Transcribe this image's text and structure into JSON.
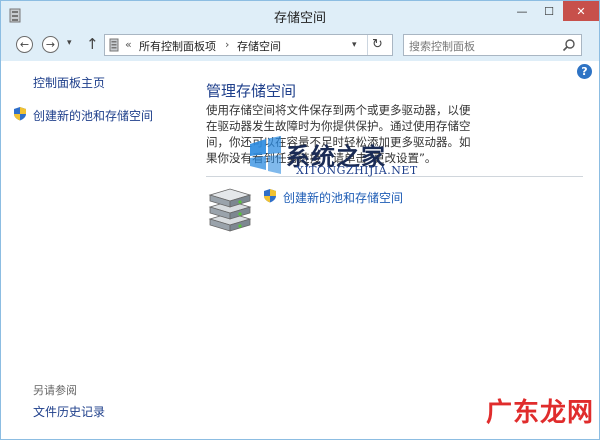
{
  "window": {
    "title": "存储空间"
  },
  "titlebar": {
    "minimize": "—",
    "maximize": "☐",
    "close": "✕"
  },
  "nav": {
    "back": "←",
    "forward": "→",
    "dropdown": "▾",
    "up": "↑",
    "breadcrumb_sep": "«",
    "crumbs": [
      "所有控制面板项",
      "存储空间"
    ],
    "crumb_arrow": "›",
    "refresh": "↻",
    "search_placeholder": "搜索控制面板"
  },
  "help": {
    "label": "?"
  },
  "sidebar": {
    "home": "控制面板主页",
    "create_pool": "创建新的池和存储空间",
    "see_also": "另请参阅",
    "file_history": "文件历史记录"
  },
  "main": {
    "title": "管理存储空间",
    "description": "使用存储空间将文件保存到两个或更多驱动器，以便在驱动器发生故障时为你提供保护。通过使用存储空间，你还可以在容量不足时轻松添加更多驱动器。如果你没有看到任务链接，请单击“更改设置”。",
    "create_link": "创建新的池和存储空间"
  },
  "watermark": {
    "title": "系统之家",
    "subtitle": "XITONGZHIJIA.NET",
    "corner": "广东龙网"
  },
  "colors": {
    "chrome": "#dfeef8",
    "link": "#1e3f8b",
    "close": "#c7504b"
  }
}
